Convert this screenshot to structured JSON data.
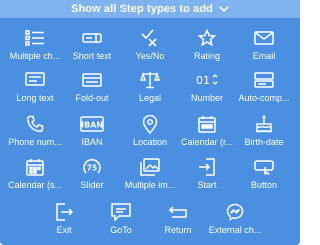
{
  "header": {
    "title": "Show all Step types to add"
  },
  "colors": {
    "panel": "#4a8fe0",
    "topbar": "#7eb3ef",
    "text": "#ffffff"
  },
  "tiles": [
    {
      "label": "Multiple ch...",
      "icon": "list-icon"
    },
    {
      "label": "Short text",
      "icon": "short-text-icon"
    },
    {
      "label": "Yes/No",
      "icon": "yes-no-icon"
    },
    {
      "label": "Rating",
      "icon": "star-icon"
    },
    {
      "label": "Email",
      "icon": "envelope-icon"
    },
    {
      "label": "Long text",
      "icon": "long-text-icon"
    },
    {
      "label": "Fold-out",
      "icon": "fold-out-icon"
    },
    {
      "label": "Legal",
      "icon": "scales-icon"
    },
    {
      "label": "Number",
      "icon": "number-icon"
    },
    {
      "label": "Auto-comp...",
      "icon": "auto-complete-icon"
    },
    {
      "label": "Phone num...",
      "icon": "phone-icon"
    },
    {
      "label": "IBAN",
      "icon": "iban-icon"
    },
    {
      "label": "Location",
      "icon": "location-pin-icon"
    },
    {
      "label": "Calendar (r...",
      "icon": "calendar-range-icon"
    },
    {
      "label": "Birth-date",
      "icon": "birthday-cake-icon"
    },
    {
      "label": "Calendar (s...",
      "icon": "calendar-single-icon"
    },
    {
      "label": "Slider",
      "icon": "slider-gauge-icon"
    },
    {
      "label": "Multiple im...",
      "icon": "multiple-images-icon"
    },
    {
      "label": "Start",
      "icon": "door-enter-icon"
    },
    {
      "label": "Button",
      "icon": "button-icon"
    },
    {
      "label": "Exit",
      "icon": "door-exit-icon"
    },
    {
      "label": "GoTo",
      "icon": "goto-message-icon"
    },
    {
      "label": "Return",
      "icon": "return-arrow-icon"
    },
    {
      "label": "External ch...",
      "icon": "messenger-icon"
    }
  ],
  "icon_badges": {
    "iban": "IBAN",
    "slider": "75",
    "number": "01"
  }
}
